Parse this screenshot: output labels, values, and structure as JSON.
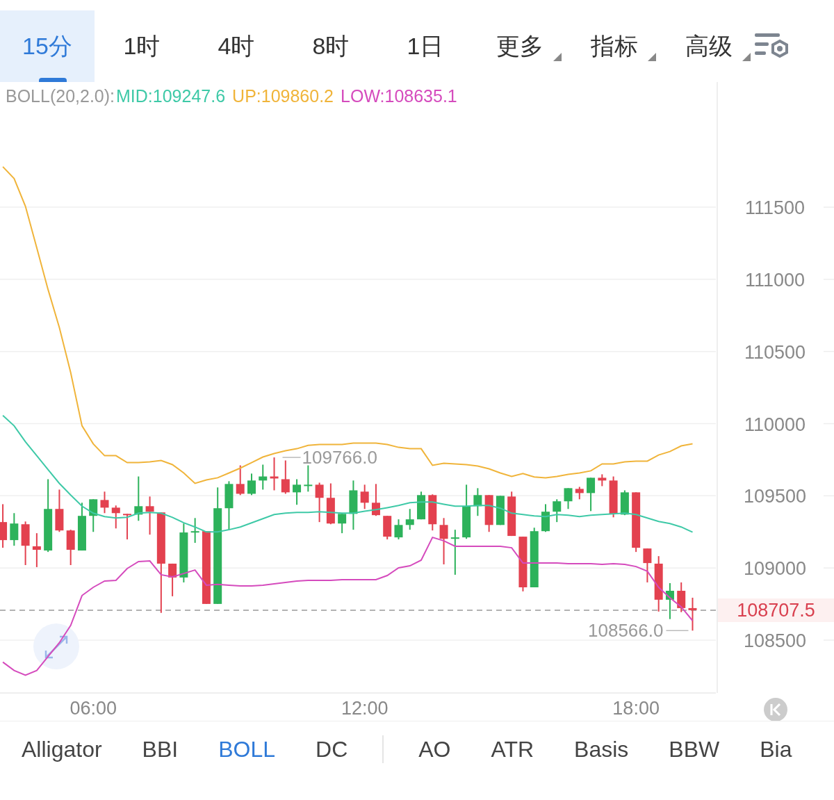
{
  "tabs": [
    {
      "label": "15分",
      "kind": "period",
      "selected": true
    },
    {
      "label": "1时",
      "kind": "period",
      "selected": false
    },
    {
      "label": "4时",
      "kind": "period",
      "selected": false
    },
    {
      "label": "8时",
      "kind": "period",
      "selected": false
    },
    {
      "label": "1日",
      "kind": "period",
      "selected": false
    },
    {
      "label": "更多",
      "kind": "menu",
      "selected": false
    },
    {
      "label": "指标",
      "kind": "menu",
      "selected": false
    },
    {
      "label": "高级",
      "kind": "menu",
      "selected": false
    }
  ],
  "legend": {
    "label": "BOLL(20,2.0):",
    "items": [
      {
        "text": "MID:109247.6",
        "color": "#3ec9a7"
      },
      {
        "text": "UP:109860.2",
        "color": "#f0b43a"
      },
      {
        "text": "LOW:108635.1",
        "color": "#d54bbd"
      }
    ]
  },
  "chart_data": {
    "type": "candlestick",
    "grid": true,
    "x": [
      4,
      4.25,
      4.5,
      4.75,
      5,
      5.25,
      5.5,
      5.75,
      6,
      6.25,
      6.5,
      6.75,
      7,
      7.25,
      7.5,
      7.75,
      8,
      8.25,
      8.5,
      8.75,
      9,
      9.25,
      9.5,
      9.75,
      10,
      10.25,
      10.5,
      10.75,
      11,
      11.25,
      11.5,
      11.75,
      12,
      12.25,
      12.5,
      12.75,
      13,
      13.25,
      13.5,
      13.75,
      14,
      14.25,
      14.5,
      14.75,
      15,
      15.25,
      15.5,
      15.75,
      16,
      16.25,
      16.5,
      16.75,
      17,
      17.25,
      17.5,
      17.75,
      18,
      18.25,
      18.5,
      18.75,
      19,
      19.25
    ],
    "xlim": [
      3.9375,
      19.765
    ],
    "ylim": [
      108134,
      112367
    ],
    "xticks": [
      {
        "value": 6,
        "label": "06:00"
      },
      {
        "value": 12,
        "label": "12:00"
      },
      {
        "value": 18,
        "label": "18:00"
      }
    ],
    "yticks": [
      {
        "value": 108500,
        "label": "108500"
      },
      {
        "value": 109000,
        "label": "109000"
      },
      {
        "value": 109500,
        "label": "109500"
      },
      {
        "value": 110000,
        "label": "110000"
      },
      {
        "value": 110500,
        "label": "110500"
      },
      {
        "value": 111000,
        "label": "111000"
      },
      {
        "value": 111500,
        "label": "111500"
      }
    ],
    "ohlc": [
      [
        109318,
        109442,
        109140,
        109193
      ],
      [
        109193,
        109380,
        109154,
        109308
      ],
      [
        109303,
        109322,
        109020,
        109154
      ],
      [
        109150,
        109241,
        109006,
        109126
      ],
      [
        109121,
        109615,
        109111,
        109409
      ],
      [
        109409,
        109543,
        109250,
        109260
      ],
      [
        109260,
        109265,
        109020,
        109126
      ],
      [
        109121,
        109452,
        109121,
        109361
      ],
      [
        109361,
        109476,
        109250,
        109476
      ],
      [
        109471,
        109529,
        109380,
        109418
      ],
      [
        109418,
        109433,
        109274,
        109380
      ],
      [
        109375,
        109375,
        109198,
        109366
      ],
      [
        109370,
        109634,
        109327,
        109428
      ],
      [
        109428,
        109495,
        109231,
        109390
      ],
      [
        109385,
        109385,
        108689,
        109030
      ],
      [
        109030,
        109030,
        108804,
        108934
      ],
      [
        108934,
        109308,
        108900,
        109246
      ],
      [
        109250,
        109346,
        109174,
        109255
      ],
      [
        109255,
        109255,
        108751,
        108751
      ],
      [
        108751,
        109558,
        108751,
        109414
      ],
      [
        109414,
        109601,
        109265,
        109582
      ],
      [
        109582,
        109711,
        109505,
        109514
      ],
      [
        109514,
        109654,
        109505,
        109606
      ],
      [
        109606,
        109716,
        109543,
        109634
      ],
      [
        109634,
        109766,
        109538,
        109620
      ],
      [
        109615,
        109745,
        109514,
        109524
      ],
      [
        109524,
        109615,
        109438,
        109577
      ],
      [
        109572,
        109711,
        109529,
        109577
      ],
      [
        109577,
        109591,
        109318,
        109486
      ],
      [
        109486,
        109586,
        109303,
        109308
      ],
      [
        109308,
        109375,
        109241,
        109375
      ],
      [
        109375,
        109606,
        109265,
        109538
      ],
      [
        109529,
        109577,
        109409,
        109452
      ],
      [
        109452,
        109582,
        109361,
        109366
      ],
      [
        109361,
        109361,
        109198,
        109217
      ],
      [
        109212,
        109337,
        109198,
        109298
      ],
      [
        109298,
        109409,
        109265,
        109337
      ],
      [
        109337,
        109529,
        109337,
        109505
      ],
      [
        109505,
        109510,
        109260,
        109303
      ],
      [
        109298,
        109346,
        109025,
        109202
      ],
      [
        109202,
        109265,
        108953,
        109212
      ],
      [
        109212,
        109577,
        109202,
        109428
      ],
      [
        109428,
        109553,
        109361,
        109505
      ],
      [
        109505,
        109505,
        109250,
        109298
      ],
      [
        109298,
        109500,
        109298,
        109500
      ],
      [
        109495,
        109529,
        109222,
        109222
      ],
      [
        109217,
        109217,
        108838,
        108866
      ],
      [
        108866,
        109279,
        108866,
        109255
      ],
      [
        109255,
        109442,
        109250,
        109390
      ],
      [
        109390,
        109476,
        109318,
        109462
      ],
      [
        109462,
        109553,
        109409,
        109553
      ],
      [
        109548,
        109562,
        109476,
        109519
      ],
      [
        109519,
        109625,
        109394,
        109625
      ],
      [
        109625,
        109649,
        109567,
        109606
      ],
      [
        109606,
        109634,
        109351,
        109375
      ],
      [
        109370,
        109538,
        109366,
        109524
      ],
      [
        109524,
        109524,
        109111,
        109140
      ],
      [
        109135,
        109135,
        108900,
        109034
      ],
      [
        109030,
        109082,
        108698,
        108780
      ],
      [
        108780,
        108895,
        108646,
        108842
      ],
      [
        108842,
        108900,
        108694,
        108722
      ],
      [
        108722,
        108794,
        108566,
        108707.5
      ]
    ],
    "series": [
      {
        "type": "line",
        "x": [
          4,
          4.25,
          4.5,
          4.75,
          5,
          5.25,
          5.5,
          5.75,
          6,
          6.25,
          6.5,
          6.75,
          7,
          7.25,
          7.5,
          7.75,
          8,
          8.25,
          8.5,
          8.75,
          9,
          9.25,
          9.5,
          9.75,
          10,
          10.25,
          10.5,
          10.75,
          11,
          11.25,
          11.5,
          11.75,
          12,
          12.25,
          12.5,
          12.75,
          13,
          13.25,
          13.5,
          13.75,
          14,
          14.25,
          14.5,
          14.75,
          15,
          15.25,
          15.5,
          15.75,
          16,
          16.25,
          16.5,
          16.75,
          17,
          17.25,
          17.5,
          17.75,
          18,
          18.25,
          18.5,
          18.75,
          19,
          19.25
        ],
        "color": "#f0b43a",
        "values": [
          111780,
          111698,
          111506,
          111218,
          110930,
          110666,
          110354,
          109985,
          109860,
          109778,
          109778,
          109730,
          109730,
          109735,
          109745,
          109716,
          109658,
          109586,
          109610,
          109625,
          109658,
          109692,
          109730,
          109769,
          109793,
          109812,
          109826,
          109850,
          109855,
          109855,
          109855,
          109865,
          109865,
          109865,
          109855,
          109836,
          109826,
          109826,
          109711,
          109726,
          109721,
          109716,
          109706,
          109687,
          109658,
          109634,
          109654,
          109630,
          109625,
          109634,
          109649,
          109658,
          109673,
          109721,
          109721,
          109735,
          109740,
          109740,
          109783,
          109807,
          109846,
          109860
        ]
      },
      {
        "type": "line",
        "x": [
          4,
          4.25,
          4.5,
          4.75,
          5,
          5.25,
          5.5,
          5.75,
          6,
          6.25,
          6.5,
          6.75,
          7,
          7.25,
          7.5,
          7.75,
          8,
          8.25,
          8.5,
          8.75,
          9,
          9.25,
          9.5,
          9.75,
          10,
          10.25,
          10.5,
          10.75,
          11,
          11.25,
          11.5,
          11.75,
          12,
          12.25,
          12.5,
          12.75,
          13,
          13.25,
          13.5,
          13.75,
          14,
          14.25,
          14.5,
          14.75,
          15,
          15.25,
          15.5,
          15.75,
          16,
          16.25,
          16.5,
          16.75,
          17,
          17.25,
          17.5,
          17.75,
          18,
          18.25,
          18.5,
          18.75,
          19,
          19.25
        ],
        "color": "#3ec9a7",
        "values": [
          110057,
          109985,
          109874,
          109778,
          109682,
          109586,
          109505,
          109428,
          109380,
          109356,
          109346,
          109351,
          109380,
          109385,
          109380,
          109351,
          109313,
          109284,
          109250,
          109250,
          109265,
          109284,
          109313,
          109342,
          109370,
          109380,
          109385,
          109385,
          109390,
          109385,
          109380,
          109380,
          109394,
          109404,
          109418,
          109433,
          109452,
          109457,
          109457,
          109442,
          109428,
          109428,
          109433,
          109433,
          109414,
          109380,
          109370,
          109361,
          109356,
          109370,
          109366,
          109356,
          109366,
          109370,
          109375,
          109380,
          109370,
          109346,
          109322,
          109308,
          109284,
          109248
        ]
      },
      {
        "type": "line",
        "x": [
          4,
          4.25,
          4.5,
          4.75,
          5,
          5.25,
          5.5,
          5.75,
          6,
          6.25,
          6.5,
          6.75,
          7,
          7.25,
          7.5,
          7.75,
          8,
          8.25,
          8.5,
          8.75,
          9,
          9.25,
          9.5,
          9.75,
          10,
          10.25,
          10.5,
          10.75,
          11,
          11.25,
          11.5,
          11.75,
          12,
          12.25,
          12.5,
          12.75,
          13,
          13.25,
          13.5,
          13.75,
          14,
          14.25,
          14.5,
          14.75,
          15,
          15.25,
          15.5,
          15.75,
          16,
          16.25,
          16.5,
          16.75,
          17,
          17.25,
          17.5,
          17.75,
          18,
          18.25,
          18.5,
          18.75,
          19,
          19.25
        ],
        "color": "#d54bbd",
        "values": [
          108348,
          108290,
          108257,
          108290,
          108386,
          108482,
          108602,
          108809,
          108866,
          108910,
          108914,
          108996,
          109044,
          109049,
          108953,
          108938,
          108962,
          108986,
          108881,
          108886,
          108881,
          108876,
          108876,
          108881,
          108890,
          108900,
          108910,
          108914,
          108914,
          108914,
          108919,
          108919,
          108919,
          108919,
          108948,
          109001,
          109015,
          109054,
          109212,
          109188,
          109150,
          109150,
          109150,
          109150,
          109150,
          109140,
          109034,
          109034,
          109034,
          109034,
          109030,
          109030,
          109030,
          109025,
          109030,
          109025,
          109010,
          108977,
          108866,
          108794,
          108730,
          108635
        ]
      }
    ],
    "annotations": [
      {
        "text": "109766.0",
        "x": 10,
        "y": 109766
      },
      {
        "text": "108566.0",
        "x": 19.25,
        "y": 108566
      }
    ],
    "ref_lines": [
      {
        "axis": "y",
        "value": 108707.5,
        "label": "108707.5"
      }
    ]
  },
  "indicators": [
    {
      "label": "Alligator",
      "selected": false,
      "divider_after": false
    },
    {
      "label": "BBI",
      "selected": false,
      "divider_after": false
    },
    {
      "label": "BOLL",
      "selected": true,
      "divider_after": false
    },
    {
      "label": "DC",
      "selected": false,
      "divider_after": true
    },
    {
      "label": "AO",
      "selected": false,
      "divider_after": false
    },
    {
      "label": "ATR",
      "selected": false,
      "divider_after": false
    },
    {
      "label": "Basis",
      "selected": false,
      "divider_after": false
    },
    {
      "label": "BBW",
      "selected": false,
      "divider_after": false
    },
    {
      "label": "Bia",
      "selected": false,
      "divider_after": false
    }
  ]
}
